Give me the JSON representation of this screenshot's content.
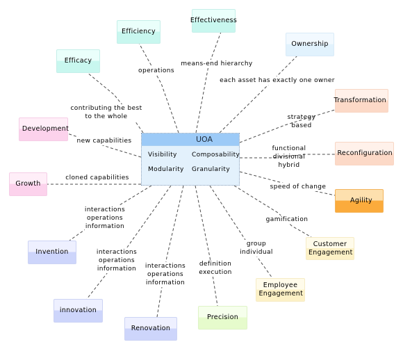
{
  "diagram": {
    "central": {
      "title": "UOA",
      "attributes": [
        "Visibility",
        "Composability",
        "Modularity",
        "Granularity"
      ]
    },
    "nodes": [
      {
        "id": "efficiency",
        "label": "Efficiency",
        "color_top": "#eafffb",
        "color_bottom": "#c8f7ef",
        "border": "#c5efe9"
      },
      {
        "id": "efficacy",
        "label": "Efficacy",
        "color_top": "#eafffb",
        "color_bottom": "#c8f7ef",
        "border": "#c5efe9"
      },
      {
        "id": "effectiveness",
        "label": "Effectiveness",
        "color_top": "#eafffb",
        "color_bottom": "#c8f7ef",
        "border": "#c5efe9"
      },
      {
        "id": "ownership",
        "label": "Ownership",
        "color_top": "#f2f9ff",
        "color_bottom": "#e1f2fd",
        "border": "#d9ebf8"
      },
      {
        "id": "transformation",
        "label": "Transformation",
        "color_top": "#fff1ea",
        "color_bottom": "#fcd9c7",
        "border": "#f8d6c4"
      },
      {
        "id": "reconfiguration",
        "label": "Reconfiguration",
        "color_top": "#fff1ea",
        "color_bottom": "#fcd9c7",
        "border": "#f8d6c4"
      },
      {
        "id": "agility",
        "label": "Agility",
        "color_top": "#fde0ae",
        "color_bottom": "#fbab3c",
        "border": "#f3b45c"
      },
      {
        "id": "customer-engagement",
        "label": "Customer Engagement",
        "color_top": "#fffbea",
        "color_bottom": "#fdf1c6",
        "border": "#f6ecc6"
      },
      {
        "id": "employee-engagement",
        "label": "Employee Engagement",
        "color_top": "#fffbea",
        "color_bottom": "#fdf1c6",
        "border": "#f6ecc6"
      },
      {
        "id": "precision",
        "label": "Precision",
        "color_top": "#f6ffec",
        "color_bottom": "#e6fbcc",
        "border": "#def3c7"
      },
      {
        "id": "renovation",
        "label": "Renovation",
        "color_top": "#eef0ff",
        "color_bottom": "#cdd5fb",
        "border": "#ccd3f4"
      },
      {
        "id": "innovation",
        "label": "innovation",
        "color_top": "#eef0ff",
        "color_bottom": "#cdd5fb",
        "border": "#ccd3f4"
      },
      {
        "id": "invention",
        "label": "Invention",
        "color_top": "#eef0ff",
        "color_bottom": "#cdd5fb",
        "border": "#ccd3f4"
      },
      {
        "id": "growth",
        "label": "Growth",
        "color_top": "#ffeef8",
        "color_bottom": "#fcd2ec",
        "border": "#f5cde6"
      },
      {
        "id": "development",
        "label": "Development",
        "color_top": "#ffeef8",
        "color_bottom": "#fcd2ec",
        "border": "#f5cde6"
      }
    ],
    "edges": [
      {
        "to": "efficiency",
        "label": "operations"
      },
      {
        "to": "efficacy",
        "label": "contributing the best\nto the whole"
      },
      {
        "to": "effectiveness",
        "label": "means-end hierarchy"
      },
      {
        "to": "ownership",
        "label": "each asset has exactly one owner"
      },
      {
        "to": "transformation",
        "label": "strategy\nbased"
      },
      {
        "to": "reconfiguration",
        "label": "functional\ndivisional\nhybrid"
      },
      {
        "to": "agility",
        "label": "speed of change"
      },
      {
        "to": "customer-engagement",
        "label": "gamification"
      },
      {
        "to": "employee-engagement",
        "label": "group\nindividual"
      },
      {
        "to": "precision",
        "label": "definition\nexecution"
      },
      {
        "to": "renovation",
        "label": "interactions\noperations\ninformation"
      },
      {
        "to": "innovation",
        "label": "interactions\noperations\ninformation"
      },
      {
        "to": "invention",
        "label": "interactions\noperations\ninformation"
      },
      {
        "to": "growth",
        "label": "cloned capabilities"
      },
      {
        "to": "development",
        "label": "new capabilities"
      }
    ]
  }
}
